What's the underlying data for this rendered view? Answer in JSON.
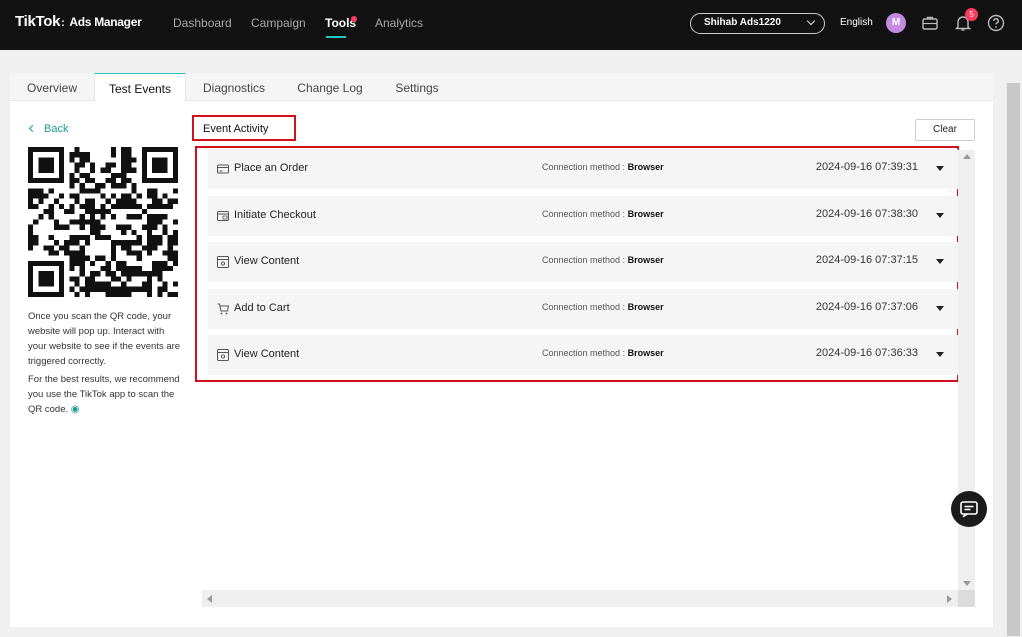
{
  "header": {
    "logo_brand": "TikTok",
    "logo_separator": ":",
    "logo_product": "Ads Manager",
    "nav": [
      {
        "label": "Dashboard",
        "active": false
      },
      {
        "label": "Campaign",
        "active": false
      },
      {
        "label": "Tools",
        "active": true
      },
      {
        "label": "Analytics",
        "active": false
      }
    ],
    "account_name": "Shihab Ads1220",
    "language": "English",
    "avatar_initial": "M",
    "notification_count": "5"
  },
  "tabs": [
    {
      "label": "Overview",
      "active": false
    },
    {
      "label": "Test Events",
      "active": true
    },
    {
      "label": "Diagnostics",
      "active": false
    },
    {
      "label": "Change Log",
      "active": false
    },
    {
      "label": "Settings",
      "active": false
    }
  ],
  "left_panel": {
    "back_label": "Back",
    "instructions_1": "Once you scan the QR code, your website will pop up. Interact with your website to see if the events are triggered correctly.",
    "instructions_2": "For the best results, we recommend you use the TikTok app to scan the QR code."
  },
  "event_activity": {
    "title": "Event Activity",
    "clear_label": "Clear",
    "events": [
      {
        "icon": "card-icon",
        "name": "Place an Order",
        "method_label": "Connection method :",
        "method": "Browser",
        "timestamp": "2024-09-16 07:39:31"
      },
      {
        "icon": "checkout-icon",
        "name": "Initiate Checkout",
        "method_label": "Connection method :",
        "method": "Browser",
        "timestamp": "2024-09-16 07:38:30"
      },
      {
        "icon": "view-content-icon",
        "name": "View Content",
        "method_label": "Connection method :",
        "method": "Browser",
        "timestamp": "2024-09-16 07:37:15"
      },
      {
        "icon": "cart-icon",
        "name": "Add to Cart",
        "method_label": "Connection method :",
        "method": "Browser",
        "timestamp": "2024-09-16 07:37:06"
      },
      {
        "icon": "view-content-icon",
        "name": "View Content",
        "method_label": "Connection method :",
        "method": "Browser",
        "timestamp": "2024-09-16 07:36:33"
      }
    ]
  },
  "colors": {
    "accent": "#20c4c0",
    "highlight_border": "#d0101a",
    "topbar_bg": "#121212"
  }
}
